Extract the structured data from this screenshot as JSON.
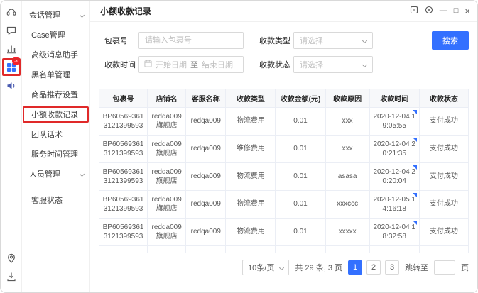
{
  "colors": {
    "accent": "#3370ff",
    "annotation": "#e02929",
    "badge": "#f5222d"
  },
  "window": {
    "controls": {
      "minimize": "—",
      "maximize": "□",
      "close": "×"
    }
  },
  "rail": {
    "badge": "3",
    "icons": [
      "customer-service-icon",
      "chat-icon",
      "stats-icon",
      "apps-grid-icon",
      "megaphone-icon"
    ],
    "bottom_icons": [
      "location-icon",
      "download-icon"
    ]
  },
  "sidebar": {
    "items": [
      {
        "label": "会话管理",
        "group": true
      },
      {
        "label": "Case管理"
      },
      {
        "label": "高级消息助手"
      },
      {
        "label": "黑名单管理"
      },
      {
        "label": "商品推荐设置"
      },
      {
        "label": "小额收款记录",
        "selected": true
      },
      {
        "label": "团队话术"
      },
      {
        "label": "服务时间管理"
      },
      {
        "label": "人员管理",
        "group": true
      },
      {
        "label": "客服状态"
      }
    ]
  },
  "header": {
    "title": "小额收款记录"
  },
  "filters": {
    "package_label": "包裹号",
    "package_placeholder": "请输入包裹号",
    "type_label": "收款类型",
    "type_placeholder": "请选择",
    "time_label": "收款时间",
    "start_placeholder": "开始日期",
    "to_label": "至",
    "end_placeholder": "结束日期",
    "status_label": "收款状态",
    "status_placeholder": "请选择",
    "search_label": "搜索"
  },
  "table": {
    "headers": [
      "包裹号",
      "店铺名",
      "客服名称",
      "收款类型",
      "收款金额(元)",
      "收款原因",
      "收款时间",
      "收款状态"
    ],
    "rows": [
      [
        "BP605693613121399593",
        "redqa009旗舰店",
        "redqa009",
        "物流费用",
        "0.01",
        "xxx",
        "2020-12-04 19:05:55",
        "支付成功"
      ],
      [
        "BP605693613121399593",
        "redqa009旗舰店",
        "redqa009",
        "维修费用",
        "0.01",
        "xxx",
        "2020-12-04 20:21:35",
        "支付成功"
      ],
      [
        "BP605693613121399593",
        "redqa009旗舰店",
        "redqa009",
        "物流费用",
        "0.01",
        "asasa",
        "2020-12-04 20:20:04",
        "支付成功"
      ],
      [
        "BP605693613121399593",
        "redqa009旗舰店",
        "redqa009",
        "物流费用",
        "0.01",
        "xxxccc",
        "2020-12-05 14:16:18",
        "支付成功"
      ],
      [
        "BP605693613121399593",
        "redqa009旗舰店",
        "redqa009",
        "物流费用",
        "0.01",
        "xxxxx",
        "2020-12-04 18:32:58",
        "支付成功"
      ]
    ]
  },
  "pagination": {
    "page_size": "10条/页",
    "total_text": "共 29 条, 3 页",
    "pages": [
      "1",
      "2",
      "3"
    ],
    "current": "1",
    "jump_label": "跳转至",
    "jump_suffix": "页"
  }
}
